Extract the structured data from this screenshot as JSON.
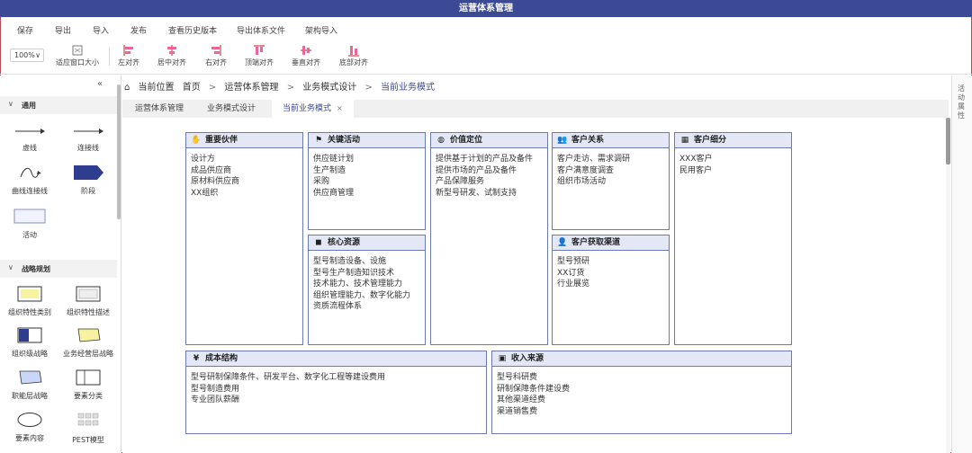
{
  "window": {
    "title": "运营体系管理"
  },
  "menu": [
    "保存",
    "导出",
    "导入",
    "发布",
    "查看历史版本",
    "导出体系文件",
    "架构导入"
  ],
  "toolbar": {
    "zoom": "100%",
    "buttons": [
      "适应窗口大小",
      "左对齐",
      "居中对齐",
      "右对齐",
      "顶端对齐",
      "垂直对齐",
      "底部对齐"
    ]
  },
  "sidebar": {
    "collapse_icon": "«",
    "sections": [
      {
        "title": "通用",
        "shapes": [
          "虚线",
          "连接线",
          "曲线连接线",
          "阶段",
          "活动"
        ]
      },
      {
        "title": "战略规划",
        "shapes": [
          "组织特性类别",
          "组织特性描述",
          "组织级战略",
          "业务经营层战略",
          "职能层战略",
          "要素分类",
          "要素内容",
          "PEST模型"
        ]
      }
    ]
  },
  "breadcrumb": {
    "prefix": "当前位置",
    "items": [
      "首页",
      "运营体系管理",
      "业务模式设计",
      "当前业务模式"
    ]
  },
  "tabs": [
    {
      "label": "运营体系管理",
      "active": false
    },
    {
      "label": "业务模式设计",
      "active": false
    },
    {
      "label": "当前业务模式",
      "active": true,
      "close": "×"
    }
  ],
  "right_panel": {
    "label": "活动属性"
  },
  "canvas": {
    "blocks": {
      "partners": {
        "title": "重要伙伴",
        "icon": "handshake-icon",
        "items": [
          "设计方",
          "成品供应商",
          "原材料供应商",
          "XX组织"
        ]
      },
      "activities": {
        "title": "关键活动",
        "icon": "flag-icon",
        "items": [
          "供应链计划",
          "生产制造",
          "采购",
          "供应商管理"
        ]
      },
      "value": {
        "title": "价值定位",
        "icon": "globe-icon",
        "items": [
          "提供基于计划的产品及备件",
          "提供市场的产品及备件",
          "产品保障服务",
          "新型号研发、试制支持"
        ]
      },
      "relations": {
        "title": "客户关系",
        "icon": "users-icon",
        "items": [
          "客户走访、需求调研",
          "客户满意度调查",
          "组织市场活动"
        ]
      },
      "segments": {
        "title": "客户细分",
        "icon": "grid-icon",
        "items": [
          "XXX客户",
          "民用客户"
        ]
      },
      "resources": {
        "title": "核心资源",
        "icon": "cube-icon",
        "items": [
          "型号制造设备、设施",
          "型号生产制造知识技术",
          "技术能力、技术管理能力",
          "组织管理能力、数字化能力",
          "资质流程体系"
        ]
      },
      "channels": {
        "title": "客户获取渠道",
        "icon": "user-icon",
        "items": [
          "型号预研",
          "XX订货",
          "行业展览"
        ]
      },
      "costs": {
        "title": "成本结构",
        "icon": "money-icon",
        "items": [
          "型号研制保障条件、研发平台、数字化工程等建设费用",
          "型号制造费用",
          "专业团队薪酬"
        ]
      },
      "revenue": {
        "title": "收入来源",
        "icon": "wallet-icon",
        "items": [
          "型号科研费",
          "研制保障条件建设费",
          "其他渠道经费",
          "渠道销售费"
        ]
      }
    }
  }
}
